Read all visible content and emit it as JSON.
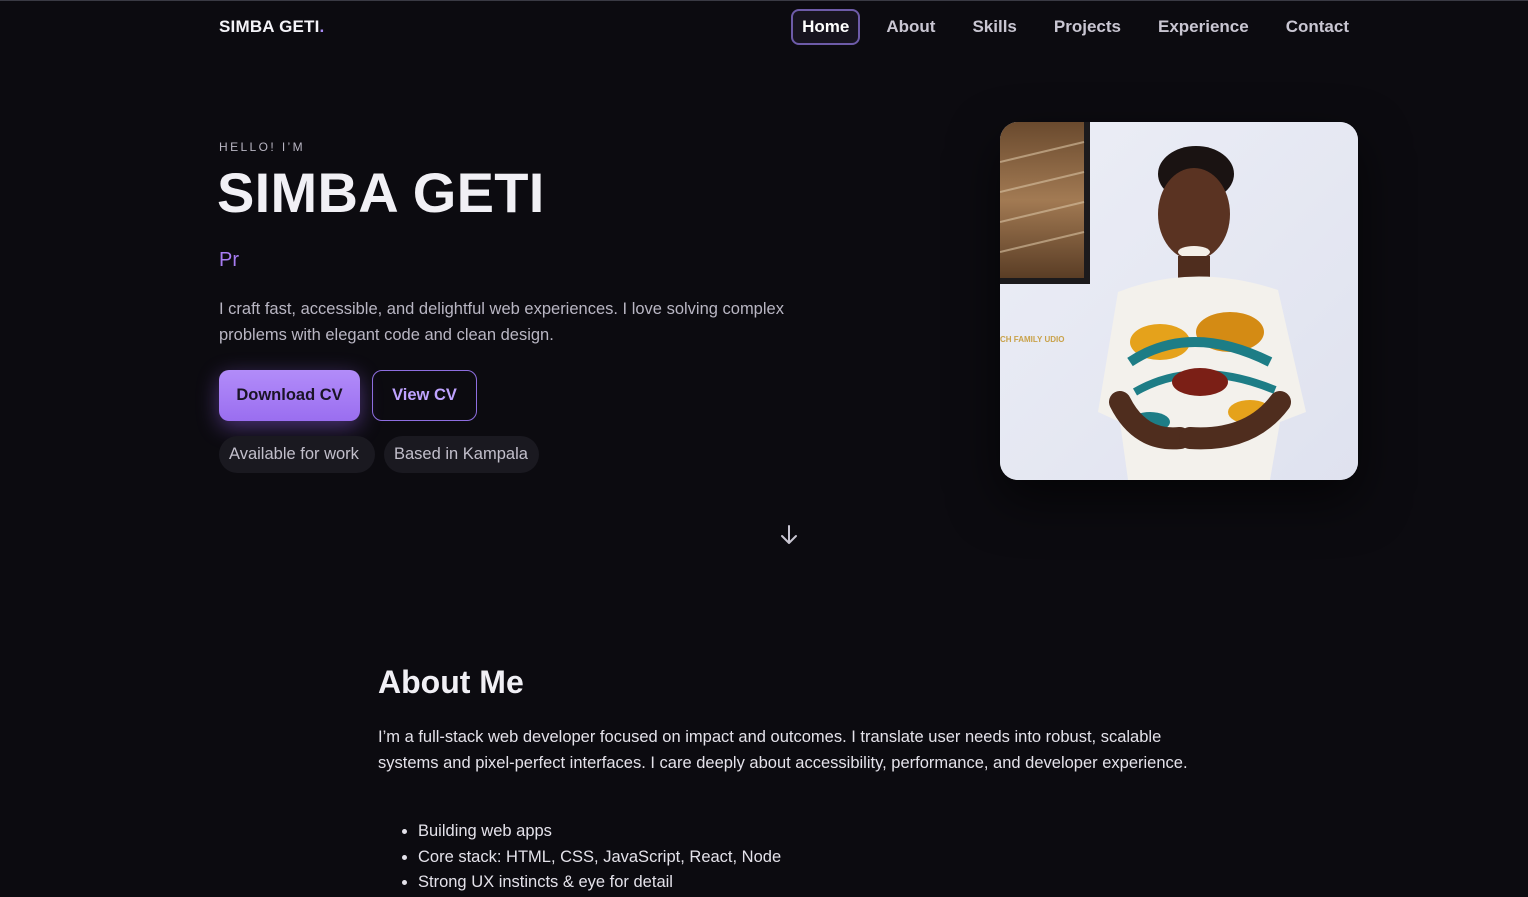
{
  "nav": {
    "brand": "SIMBA GETI",
    "brand_dot": ".",
    "links": [
      {
        "label": "Home"
      },
      {
        "label": "About"
      },
      {
        "label": "Skills"
      },
      {
        "label": "Projects"
      },
      {
        "label": "Experience"
      },
      {
        "label": "Contact"
      }
    ],
    "active_link": "Home"
  },
  "hero": {
    "greeting": "HELLO! I’M",
    "name": "SIMBA GETI",
    "role_typed": "Pr",
    "intro": "I craft fast, accessible, and delightful web experiences. I love solving complex problems with elegant code and clean design.",
    "download_label": "Download CV",
    "view_label": "View CV",
    "chips": [
      "Available for work",
      "Based in Kampala"
    ],
    "photo_watermark": "CH FAMILY UDIO",
    "scroll_icon": "arrow-down-icon"
  },
  "about": {
    "title": "About Me",
    "text": "I’m a full-stack web developer focused on impact and outcomes. I translate user needs into robust, scalable systems and pixel-perfect interfaces. I care deeply about accessibility, performance, and developer experience.",
    "bullets": [
      "Building web apps",
      "Core stack: HTML, CSS, JavaScript, React, Node",
      "Strong UX instincts & eye for detail"
    ]
  },
  "colors": {
    "background": "#0c0b10",
    "accent": "#a77cf2",
    "button_primary": "#a57cf5"
  }
}
